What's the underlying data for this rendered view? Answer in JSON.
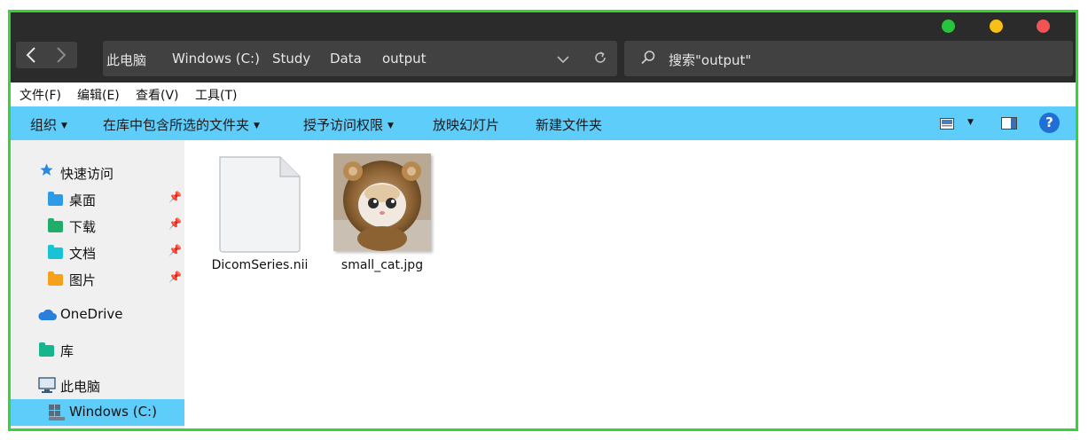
{
  "colors": {
    "window_close": "#f25353",
    "window_min": "#f7c016",
    "window_max": "#29c43f",
    "accent": "#5fcdfa",
    "titlebar": "#2b2b2b",
    "frame_border": "#33d633"
  },
  "nav": {
    "back_icon": "chevron-left-icon",
    "forward_icon": "chevron-right-icon"
  },
  "address": {
    "crumbs": [
      "此电脑",
      "Windows (C:)",
      "Study",
      "Data",
      "output"
    ],
    "dropdown_icon": "chevron-down-icon",
    "refresh_icon": "refresh-icon"
  },
  "search": {
    "placeholder": "搜索\"output\"",
    "icon": "search-icon"
  },
  "menubar": [
    "文件(F)",
    "编辑(E)",
    "查看(V)",
    "工具(T)"
  ],
  "commands": {
    "organize": "组织",
    "include_in_library": "在库中包含所选的文件夹",
    "share_with": "授予访问权限",
    "slideshow": "放映幻灯片",
    "new_folder": "新建文件夹",
    "help": "?"
  },
  "sidebar": {
    "quick_access": "快速访问",
    "desktop": "桌面",
    "downloads": "下载",
    "documents": "文档",
    "pictures": "图片",
    "onedrive": "OneDrive",
    "libraries": "库",
    "this_pc": "此电脑",
    "drive_c": "Windows (C:)"
  },
  "files": [
    {
      "name": "DicomSeries.nii",
      "icon": "generic-file-icon"
    },
    {
      "name": "small_cat.jpg",
      "icon": "image-thumbnail-cat"
    }
  ]
}
